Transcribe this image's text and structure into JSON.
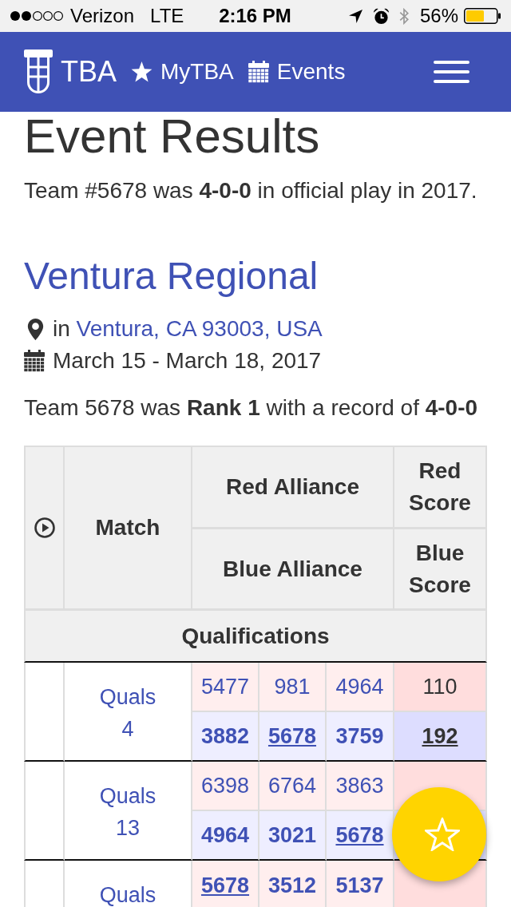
{
  "status_bar": {
    "carrier": "Verizon",
    "network": "LTE",
    "time": "2:16 PM",
    "battery": "56%"
  },
  "navbar": {
    "brand": "TBA",
    "links": [
      {
        "kind": "star",
        "label": "MyTBA"
      },
      {
        "kind": "calendar",
        "label": "Events"
      }
    ]
  },
  "page": {
    "title": "Event Results",
    "summary": "Team #5678 was **4-0-0** in official play in 2017."
  },
  "event": {
    "name": "Ventura Regional",
    "location_prefix": "in",
    "location": "Ventura, CA 93003, USA",
    "dates": "March 15 - March 18, 2017",
    "summary": "Team 5678 was **Rank 1** with a record of **4-0-0**"
  },
  "table": {
    "headers": {
      "match": "Match",
      "red_alliance": "Red Alliance",
      "red_score": "Red Score",
      "blue_alliance": "Blue Alliance",
      "blue_score": "Blue Score"
    },
    "sections": [
      {
        "title": "Qualifications",
        "matches": [
          {
            "label": "Quals 4",
            "alliances": [
              {
                "kind": "red",
                "won": false,
                "teams": [
                  {
                    "number": "5477",
                    "current": false
                  },
                  {
                    "number": "981",
                    "current": false
                  },
                  {
                    "number": "4964",
                    "current": false
                  }
                ],
                "score": "110"
              },
              {
                "kind": "blue",
                "won": true,
                "teams": [
                  {
                    "number": "3882",
                    "current": false
                  },
                  {
                    "number": "5678",
                    "current": true
                  },
                  {
                    "number": "3759",
                    "current": false
                  }
                ],
                "score": "192"
              }
            ]
          },
          {
            "label": "Quals 13",
            "alliances": [
              {
                "kind": "red",
                "won": false,
                "teams": [
                  {
                    "number": "6398",
                    "current": false
                  },
                  {
                    "number": "6764",
                    "current": false
                  },
                  {
                    "number": "3863",
                    "current": false
                  }
                ]
              },
              {
                "kind": "blue",
                "won": true,
                "teams": [
                  {
                    "number": "4964",
                    "current": false
                  },
                  {
                    "number": "3021",
                    "current": false
                  },
                  {
                    "number": "5678",
                    "current": true
                  }
                ]
              }
            ]
          },
          {
            "label": "Quals",
            "alliances": [
              {
                "kind": "red",
                "won": true,
                "teams": [
                  {
                    "number": "5678",
                    "current": true
                  },
                  {
                    "number": "3512",
                    "current": false
                  },
                  {
                    "number": "5137",
                    "current": false
                  }
                ]
              }
            ]
          }
        ]
      }
    ]
  }
}
